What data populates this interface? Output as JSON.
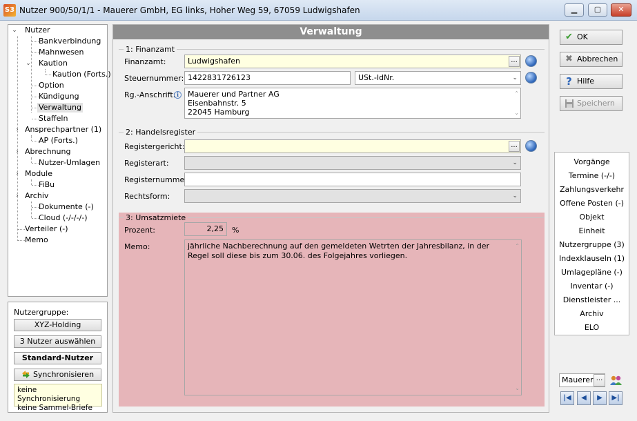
{
  "window": {
    "title": "Nutzer 900/50/1/1 - Mauerer GmbH, EG links, Hoher Weg 59, 67059 Ludwigshafen",
    "app_icon_text": "S3"
  },
  "tree": {
    "items": [
      {
        "label": "Nutzer"
      },
      {
        "label": "Bankverbindung"
      },
      {
        "label": "Mahnwesen"
      },
      {
        "label": "Kaution"
      },
      {
        "label": "Kaution (Forts.)"
      },
      {
        "label": "Option"
      },
      {
        "label": "Kündigung"
      },
      {
        "label": "Verwaltung"
      },
      {
        "label": "Staffeln"
      },
      {
        "label": "Ansprechpartner (1)"
      },
      {
        "label": "AP (Forts.)"
      },
      {
        "label": "Abrechnung"
      },
      {
        "label": "Nutzer-Umlagen"
      },
      {
        "label": "Module"
      },
      {
        "label": "FiBu"
      },
      {
        "label": "Archiv"
      },
      {
        "label": "Dokumente (-)"
      },
      {
        "label": "Cloud (-/-/-/-)"
      },
      {
        "label": "Verteiler (-)"
      },
      {
        "label": "Memo"
      }
    ]
  },
  "group": {
    "label": "Nutzergruppe:",
    "holding_button": "XYZ-Holding",
    "select_button": "3 Nutzer auswählen",
    "standard_button": "Standard-Nutzer",
    "sync_button": "Synchronisieren",
    "note_line1": "keine Synchronisierung",
    "note_line2": "keine Sammel-Briefe"
  },
  "main": {
    "header": "Verwaltung",
    "finanzamt": {
      "section_title": "1: Finanzamt",
      "finanzamt_label": "Finanzamt:",
      "finanzamt_value": "Ludwigshafen",
      "steuernummer_label": "Steuernummer:",
      "steuernummer_value": "1422831726123",
      "ust_type": "USt.-IdNr.",
      "rg_label": "Rg.-Anschrift:",
      "rg_line1": "Mauerer und Partner AG",
      "rg_line2": "Eisenbahnstr. 5",
      "rg_line3": "22045 Hamburg"
    },
    "handelsregister": {
      "section_title": "2: Handelsregister",
      "gericht_label": "Registergericht:",
      "gericht_value": "",
      "art_label": "Registerart:",
      "art_value": "",
      "nummer_label": "Registernummer:",
      "nummer_value": "",
      "rechtsform_label": "Rechtsform:",
      "rechtsform_value": ""
    },
    "umsatzmiete": {
      "section_title": "3: Umsatzmiete",
      "prozent_label": "Prozent:",
      "prozent_value": "2,25",
      "prozent_unit": "%",
      "memo_label": "Memo:",
      "memo_text": "jährliche Nachberechnung auf den gemeldeten Wetrten der Jahresbilanz, in der Regel soll diese bis zum 30.06. des Folgejahres vorliegen."
    }
  },
  "actions": {
    "ok": "OK",
    "abbrechen": "Abbrechen",
    "hilfe": "Hilfe",
    "speichern": "Speichern"
  },
  "links": [
    "Vorgänge",
    "Termine (-/-)",
    "Zahlungsverkehr",
    "Offene Posten (-)",
    "Objekt",
    "Einheit",
    "Nutzergruppe (3)",
    "Indexklauseln (1)",
    "Umlagepläne (-)",
    "Inventar (-)",
    "Dienstleister ...",
    "Archiv",
    "ELO"
  ],
  "user": {
    "name": "Mauerer"
  },
  "colors": {
    "umsatz_bg": "#e6b5b9",
    "header_bg": "#8e8e8e",
    "field_yellow": "#ffffe1"
  }
}
